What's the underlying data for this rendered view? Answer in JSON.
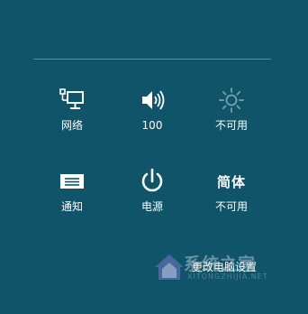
{
  "tiles": {
    "network": {
      "label": "网络",
      "icon": "network-icon"
    },
    "volume": {
      "label": "100",
      "icon": "volume-icon"
    },
    "brightness": {
      "label": "不可用",
      "icon": "brightness-icon"
    },
    "notifications": {
      "label": "通知",
      "icon": "notification-icon"
    },
    "power": {
      "label": "电源",
      "icon": "power-icon"
    },
    "keyboard": {
      "glyph": "简体",
      "label": "不可用",
      "icon": "language-icon"
    }
  },
  "footer": {
    "change_settings_label": "更改电脑设置"
  },
  "watermark": {
    "text": "系统之家",
    "subtext": "XITONGZHIJIA.NET"
  }
}
